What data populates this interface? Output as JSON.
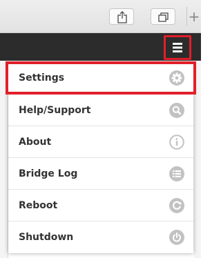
{
  "browser": {
    "share_icon": "share-icon",
    "tabs_icon": "tabs-icon",
    "new_tab_label": "+"
  },
  "header": {
    "menu_icon": "hamburger-menu-icon"
  },
  "menu": {
    "items": [
      {
        "label": "Settings",
        "icon": "gear-icon",
        "selected": true
      },
      {
        "label": "Help/Support",
        "icon": "search-icon",
        "selected": false
      },
      {
        "label": "About",
        "icon": "info-icon",
        "selected": false
      },
      {
        "label": "Bridge Log",
        "icon": "list-icon",
        "selected": false
      },
      {
        "label": "Reboot",
        "icon": "reboot-icon",
        "selected": false
      },
      {
        "label": "Shutdown",
        "icon": "power-icon",
        "selected": false
      }
    ]
  },
  "colors": {
    "highlight": "#e01f2a",
    "header_bg": "#2c2c2c",
    "icon_gray": "#c2c2c2",
    "label_text": "#333333"
  }
}
